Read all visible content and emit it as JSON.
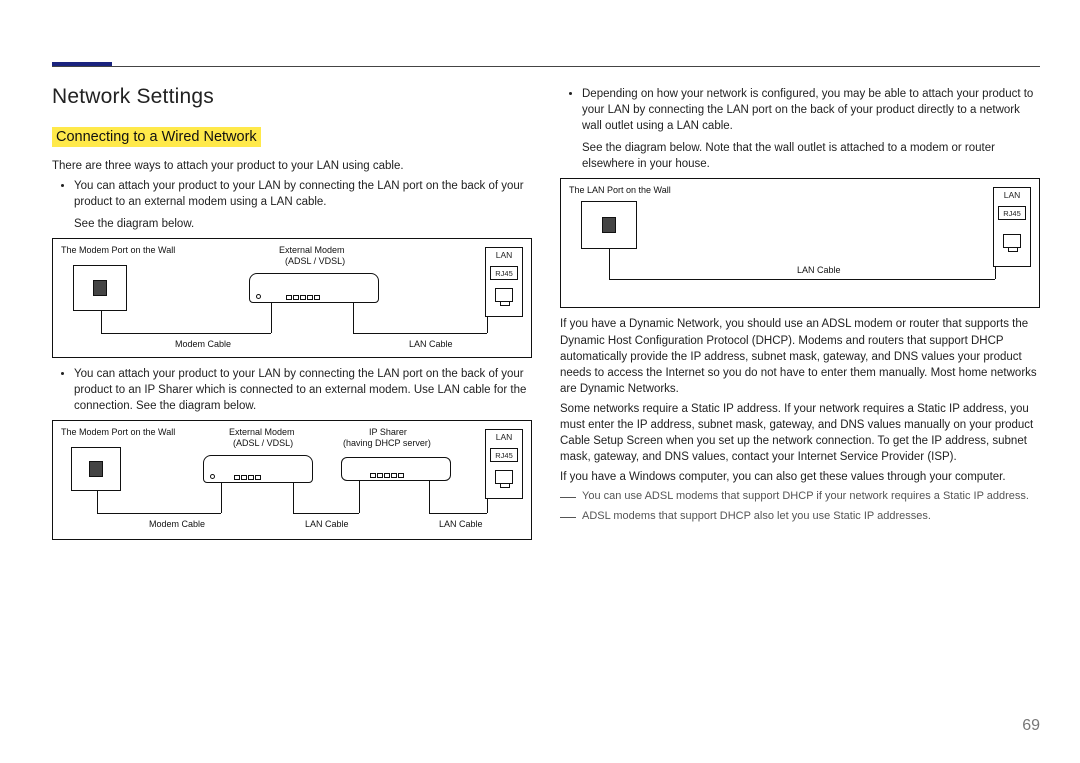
{
  "header": {
    "title": "Network Settings"
  },
  "section": {
    "subtitle": "Connecting to a Wired Network"
  },
  "left": {
    "intro": "There are three ways to attach your product to your LAN using cable.",
    "bullet1": "You can attach your product to your LAN by connecting the LAN port on the back of your product to an external modem using a LAN cable.",
    "bullet1_sub": "See the diagram below.",
    "bullet2": "You can attach your product to your LAN by connecting the LAN port on the back of your product to an IP Sharer which is connected to an external modem. Use LAN cable for the connection. See the diagram below."
  },
  "right": {
    "bullet3": "Depending on how your network is configured, you may be able to attach your product to your LAN by connecting the LAN port on the back of your product directly to a network wall outlet using a LAN cable.",
    "bullet3_sub": "See the diagram below. Note that the wall outlet is attached to a modem or router elsewhere in your house.",
    "para1": "If you have a Dynamic Network, you should use an ADSL modem or router that supports the Dynamic Host Configuration Protocol (DHCP). Modems and routers that support DHCP automatically provide the IP address, subnet mask, gateway, and DNS values your product needs to access the Internet so you do not have to enter them manually. Most home networks are Dynamic Networks.",
    "para2": "Some networks require a Static IP address. If your network requires a Static IP address, you must enter the IP address, subnet mask, gateway, and DNS values manually on your product Cable Setup Screen when you set up the network connection. To get the IP address, subnet mask, gateway, and DNS values, contact your Internet Service Provider (ISP).",
    "para3": "If you have a Windows computer, you can also get these values through your computer.",
    "note1": "You can use ADSL modems that support DHCP if your network requires a Static IP address.",
    "note2": "ADSL modems that support DHCP also let you use Static IP addresses."
  },
  "labels": {
    "modem_port_wall": "The Modem Port on the Wall",
    "lan_port_wall": "The LAN Port on the Wall",
    "external_modem": "External Modem",
    "adsl_vdsl": "(ADSL / VDSL)",
    "ip_sharer": "IP Sharer",
    "dhcp_server": "(having DHCP server)",
    "modem_cable": "Modem Cable",
    "lan_cable": "LAN Cable",
    "lan": "LAN",
    "rj45": "RJ45"
  },
  "page_number": "69"
}
